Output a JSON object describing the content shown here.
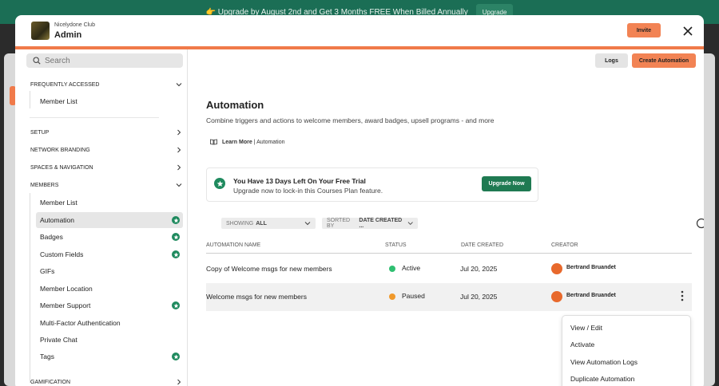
{
  "promo": {
    "text": "👉 Upgrade by August 2nd and Get 3 Months FREE When Billed Annually",
    "button": "Upgrade"
  },
  "header": {
    "club_name": "Nicelydone Club",
    "title": "Admin",
    "invite_label": "Invite"
  },
  "sidebar": {
    "search_placeholder": "Search",
    "frequently_accessed": "FREQUENTLY ACCESSED",
    "frequent_items": [
      "Member List"
    ],
    "setup": "SETUP",
    "network_branding": "NETWORK BRANDING",
    "spaces_navigation": "SPACES & NAVIGATION",
    "members": "MEMBERS",
    "member_items": [
      {
        "label": "Member List",
        "badge": false
      },
      {
        "label": "Automation",
        "badge": true,
        "active": true
      },
      {
        "label": "Badges",
        "badge": true
      },
      {
        "label": "Custom Fields",
        "badge": true
      },
      {
        "label": "GIFs",
        "badge": false
      },
      {
        "label": "Member Location",
        "badge": false
      },
      {
        "label": "Member Support",
        "badge": true
      },
      {
        "label": "Multi-Factor Authentication",
        "badge": false
      },
      {
        "label": "Private Chat",
        "badge": false
      },
      {
        "label": "Tags",
        "badge": true
      }
    ],
    "gamification": "GAMIFICATION"
  },
  "toolbar": {
    "logs_label": "Logs",
    "create_label": "Create Automation"
  },
  "page": {
    "title": "Automation",
    "description": "Combine triggers and actions to welcome members, award badges, upsell programs - and more",
    "learn_more": "Learn More",
    "learn_more_suffix": "| Automation"
  },
  "trial": {
    "title": "You Have 13 Days Left On Your Free Trial",
    "subtitle": "Upgrade now to lock-in this Courses Plan feature.",
    "button": "Upgrade Now"
  },
  "filters": {
    "showing_prefix": "SHOWING",
    "showing_value": "ALL",
    "sorted_prefix": "SORTED BY",
    "sorted_value": "DATE CREATED ..."
  },
  "table": {
    "columns": [
      "AUTOMATION NAME",
      "STATUS",
      "DATE CREATED",
      "CREATOR"
    ],
    "rows": [
      {
        "name": "Copy of Welcome msgs for new members",
        "status": "Active",
        "status_color": "#2fbf71",
        "date": "Jul 20, 2025",
        "creator": "Bertrand Bruandet"
      },
      {
        "name": "Welcome msgs for new members",
        "status": "Paused",
        "status_color": "#f0992b",
        "date": "Jul 20, 2025",
        "creator": "Bertrand Bruandet"
      }
    ]
  },
  "context_menu": {
    "items": [
      "View / Edit",
      "Activate",
      "View Automation Logs",
      "Duplicate Automation"
    ]
  },
  "colors": {
    "accent": "#f07a4a",
    "green": "#1f8a5e"
  }
}
